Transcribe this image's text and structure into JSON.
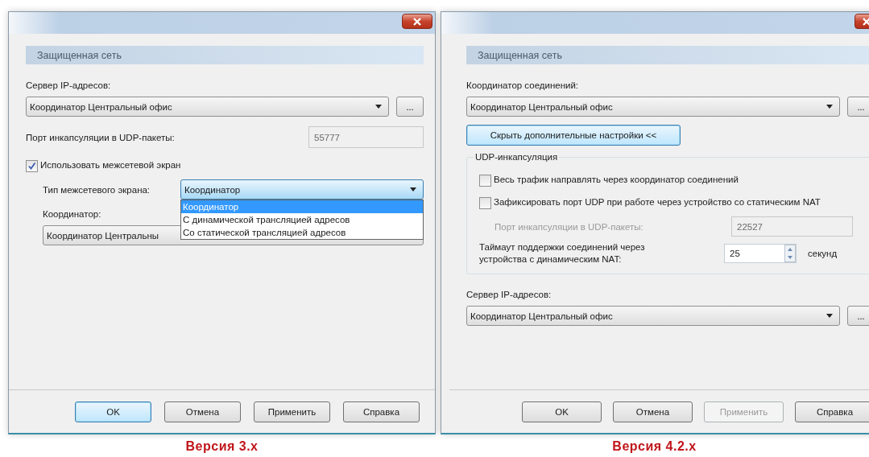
{
  "dialogs": [
    {
      "section_title": "Защищенная сеть",
      "caption": "Версия 3.x",
      "controls": [
        {
          "kind": "label",
          "text": "Сервер IP-адресов:"
        },
        {
          "kind": "combo",
          "value": "Координатор Центральный офис",
          "more": "..."
        },
        {
          "kind": "field",
          "label": "Порт инкапсуляции в UDP-пакеты:",
          "value": "55777",
          "disabled": true,
          "label_disabled": false
        },
        {
          "kind": "checkbox",
          "label": "Использовать межсетевой экран",
          "checked": true,
          "children": [
            {
              "kind": "combo_inline",
              "label": "Тип межсетевого экрана:",
              "value": "Координатор",
              "focused": true,
              "options": [
                {
                  "text": "Координатор",
                  "selected": true
                },
                {
                  "text": "С динамической трансляцией адресов",
                  "selected": false
                },
                {
                  "text": "Со статической трансляцией адресов",
                  "selected": false
                }
              ]
            },
            {
              "kind": "label",
              "text": "Координатор:"
            },
            {
              "kind": "combo",
              "value": "Координатор Центральны"
            }
          ]
        }
      ],
      "buttons": [
        {
          "label": "OK",
          "focused": true,
          "disabled": false
        },
        {
          "label": "Отмена",
          "focused": false,
          "disabled": false
        },
        {
          "label": "Применить",
          "focused": false,
          "disabled": false
        },
        {
          "label": "Справка",
          "focused": false,
          "disabled": false
        }
      ]
    },
    {
      "section_title": "Защищенная сеть",
      "caption": "Версия 4.2.x",
      "controls": [
        {
          "kind": "label",
          "text": "Координатор соединений:"
        },
        {
          "kind": "combo",
          "value": "Координатор Центральный офис",
          "more": "..."
        },
        {
          "kind": "button",
          "label": "Скрыть дополнительные настройки <<",
          "focused": true
        },
        {
          "kind": "group",
          "legend": "UDP-инкапсуляция",
          "children": [
            {
              "kind": "checkbox",
              "label": "Весь трафик направлять через координатор соединений",
              "checked": false
            },
            {
              "kind": "checkbox",
              "label": "Зафиксировать порт UDP при работе через устройство со статическим NAT",
              "checked": false,
              "children": [
                {
                  "kind": "field",
                  "label": "Порт инкапсуляции в UDP-пакеты:",
                  "value": "22527",
                  "disabled": true,
                  "label_disabled": true
                }
              ]
            },
            {
              "kind": "spin",
              "label": "Таймаут поддержки соединений через устройства с динамическим NAT:",
              "value": "25",
              "unit": "секунд"
            }
          ]
        },
        {
          "kind": "label",
          "text": "Сервер IP-адресов:"
        },
        {
          "kind": "combo",
          "value": "Координатор Центральный офис",
          "more": "..."
        }
      ],
      "buttons": [
        {
          "label": "OK",
          "focused": false,
          "disabled": false
        },
        {
          "label": "Отмена",
          "focused": false,
          "disabled": false
        },
        {
          "label": "Применить",
          "focused": false,
          "disabled": true
        },
        {
          "label": "Справка",
          "focused": false,
          "disabled": false
        }
      ]
    }
  ]
}
